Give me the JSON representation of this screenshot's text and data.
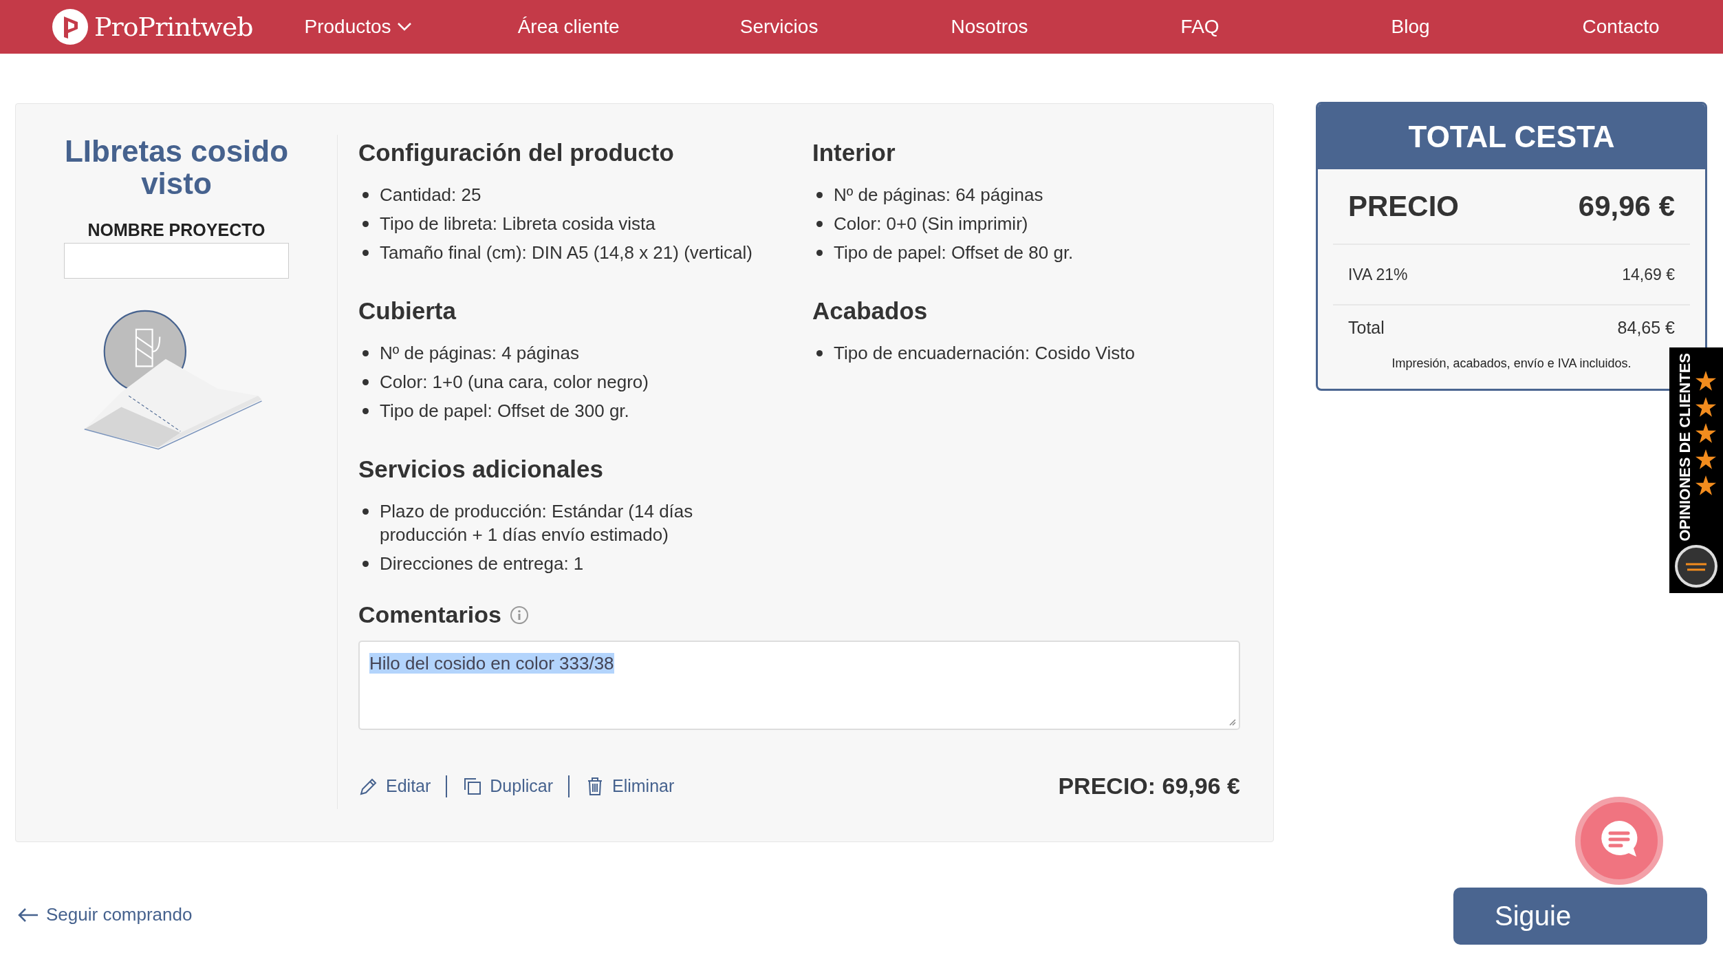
{
  "header": {
    "logo_text": "ProPrintweb",
    "nav": [
      {
        "label": "Productos",
        "dropdown": true
      },
      {
        "label": "Área cliente",
        "dropdown": false
      },
      {
        "label": "Servicios",
        "dropdown": false
      },
      {
        "label": "Nosotros",
        "dropdown": false
      },
      {
        "label": "FAQ",
        "dropdown": false
      },
      {
        "label": "Blog",
        "dropdown": false
      },
      {
        "label": "Contacto",
        "dropdown": false
      }
    ]
  },
  "product": {
    "title": "LIbretas cosido visto",
    "project_name_label": "NOMBRE PROYECTO"
  },
  "sections": [
    {
      "title": "Configuración del producto",
      "items": [
        "Cantidad: 25",
        "Tipo de libreta: Libreta cosida vista",
        "Tamaño final (cm): DIN A5 (14,8 x 21) (vertical)"
      ]
    },
    {
      "title": "Interior",
      "items": [
        "Nº de páginas: 64 páginas",
        "Color: 0+0 (Sin imprimir)",
        "Tipo de papel: Offset de 80 gr."
      ]
    },
    {
      "title": "Cubierta",
      "items": [
        "Nº de páginas: 4 páginas",
        "Color: 1+0 (una cara, color negro)",
        "Tipo de papel: Offset de 300 gr."
      ]
    },
    {
      "title": "Acabados",
      "items": [
        "Tipo de encuadernación: Cosido Visto"
      ]
    },
    {
      "title": "Servicios adicionales",
      "items": [
        "Plazo de producción: Estándar (14 días producción + 1 días envío estimado)",
        "Direcciones de entrega: 1"
      ]
    }
  ],
  "comments": {
    "title": "Comentarios",
    "value": "Hilo del cosido en color 333/38",
    "text_selected": true
  },
  "actions": [
    {
      "label": "Editar",
      "kind": "edit"
    },
    {
      "label": "Duplicar",
      "kind": "duplicate"
    },
    {
      "label": "Eliminar",
      "kind": "delete"
    }
  ],
  "item_price": "PRECIO: 69,96 €",
  "cart_total": {
    "title": "TOTAL CESTA",
    "price_label": "PRECIO",
    "price": "69,96 €",
    "rows": [
      {
        "label": "IVA 21%",
        "value": "14,69 €"
      },
      {
        "label": "Total",
        "value": "84,65 €"
      }
    ],
    "note": "Impresión, acabados, envío e IVA incluidos."
  },
  "reviews_widget": {
    "label": "OPINIONES DE CLIENTES"
  },
  "continue_link": "Seguir comprando",
  "next_button": "Siguie"
}
